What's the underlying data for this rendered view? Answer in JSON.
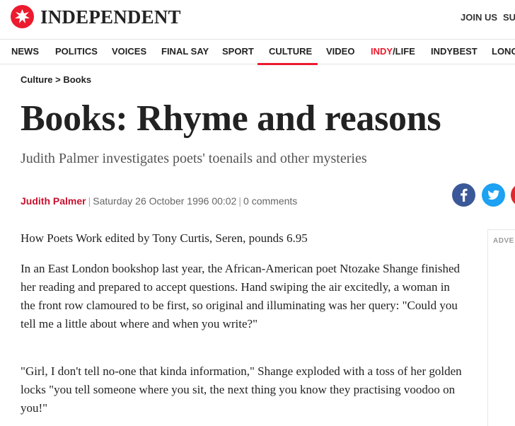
{
  "header": {
    "logo_text": "INDEPENDENT",
    "join_label": "JOIN US",
    "subscribe_label": "SUB",
    "brand_color": "#ec1a2e"
  },
  "nav": {
    "items": [
      "NEWS",
      "POLITICS",
      "VOICES",
      "FINAL SAY",
      "SPORT",
      "CULTURE",
      "VIDEO",
      "INDY",
      "/LIFE",
      "INDYBEST",
      "LONG"
    ],
    "active": "CULTURE"
  },
  "article": {
    "breadcrumb": "Culture > Books",
    "headline": "Books: Rhyme and reasons",
    "standfirst": "Judith Palmer investigates poets' toenails and other mysteries",
    "author": "Judith Palmer",
    "date": "Saturday 26 October 1996 00:02",
    "comments": "0 comments",
    "paragraphs": [
      "How Poets Work edited by Tony Curtis, Seren, pounds 6.95",
      "In an East London bookshop last year, the African-American poet Ntozake Shange finished her reading and prepared to accept questions. Hand swiping the air excitedly, a woman in the front row clamoured to be first, so original and illuminating was her query: \"Could you tell me a little about where and when you write?\"",
      "\"Girl, I don't tell no-one that kinda information,\" Shange exploded with a toss of her golden locks \"you tell someone where you sit, the next thing you know they practising voodoo on you!\""
    ]
  },
  "share": {
    "icons": [
      "facebook-icon",
      "twitter-icon",
      "share-icon"
    ],
    "facebook_color": "#3b5998",
    "twitter_color": "#1da1f2"
  },
  "sidebar": {
    "advert_label": "ADVE"
  }
}
